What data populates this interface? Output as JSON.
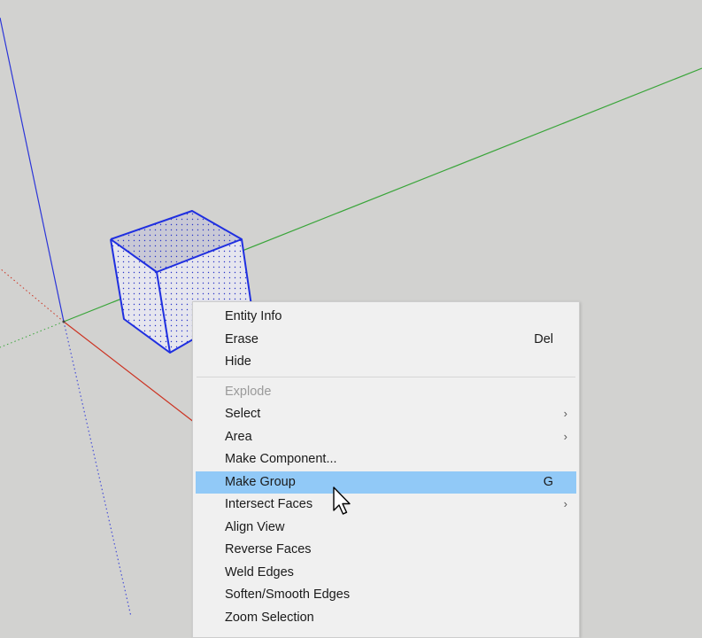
{
  "context_menu": {
    "items": [
      {
        "label": "Entity Info",
        "shortcut": "",
        "submenu": false,
        "disabled": false,
        "highlighted": false
      },
      {
        "label": "Erase",
        "shortcut": "Del",
        "submenu": false,
        "disabled": false,
        "highlighted": false
      },
      {
        "label": "Hide",
        "shortcut": "",
        "submenu": false,
        "disabled": false,
        "highlighted": false
      },
      {
        "separator": true
      },
      {
        "label": "Explode",
        "shortcut": "",
        "submenu": false,
        "disabled": true,
        "highlighted": false
      },
      {
        "label": "Select",
        "shortcut": "",
        "submenu": true,
        "disabled": false,
        "highlighted": false
      },
      {
        "label": "Area",
        "shortcut": "",
        "submenu": true,
        "disabled": false,
        "highlighted": false
      },
      {
        "label": "Make Component...",
        "shortcut": "",
        "submenu": false,
        "disabled": false,
        "highlighted": false
      },
      {
        "label": "Make Group",
        "shortcut": "G",
        "submenu": false,
        "disabled": false,
        "highlighted": true
      },
      {
        "label": "Intersect Faces",
        "shortcut": "",
        "submenu": true,
        "disabled": false,
        "highlighted": false
      },
      {
        "label": "Align View",
        "shortcut": "",
        "submenu": false,
        "disabled": false,
        "highlighted": false
      },
      {
        "label": "Reverse Faces",
        "shortcut": "",
        "submenu": false,
        "disabled": false,
        "highlighted": false
      },
      {
        "label": "Weld Edges",
        "shortcut": "",
        "submenu": false,
        "disabled": false,
        "highlighted": false
      },
      {
        "label": "Soften/Smooth Edges",
        "shortcut": "",
        "submenu": false,
        "disabled": false,
        "highlighted": false
      },
      {
        "label": "Zoom Selection",
        "shortcut": "",
        "submenu": false,
        "disabled": false,
        "highlighted": false
      }
    ],
    "submenu_icon": "chevron-right-icon"
  },
  "scene": {
    "background": "#d2d2d0",
    "axis_colors": {
      "blue": "#2b35d8",
      "green": "#3aa53a",
      "red": "#cc3322"
    },
    "selection_color": "#1f2fe0",
    "cursor_icon": "arrow-pointer-icon"
  }
}
